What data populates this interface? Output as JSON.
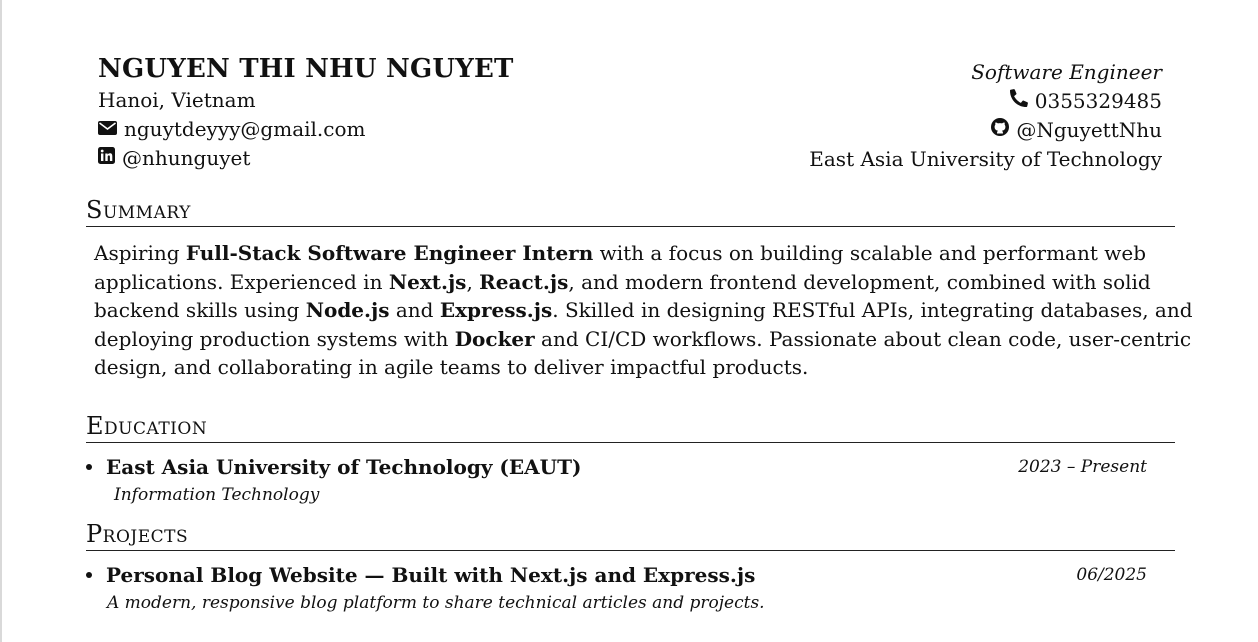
{
  "header": {
    "name": "NGUYEN THI NHU NGUYET",
    "location": "Hanoi, Vietnam",
    "email": "nguytdeyyy@gmail.com",
    "linkedin": "@nhunguyet",
    "role": "Software Engineer",
    "phone": "0355329485",
    "github": "@NguyettNhu",
    "university": "East Asia University of Technology"
  },
  "summary": {
    "title": "Summary",
    "l1_a": "Aspiring ",
    "l1_b": "Full-Stack Software Engineer Intern",
    "l1_c": " with a focus on building scalable and performant web",
    "l2_a": "applications. Experienced in ",
    "l2_b": "Next.js",
    "l2_c": ", ",
    "l2_d": "React.js",
    "l2_e": ", and modern frontend development, combined with solid",
    "l3_a": "backend skills using ",
    "l3_b": "Node.js",
    "l3_c": " and ",
    "l3_d": "Express.js",
    "l3_e": ". Skilled in designing RESTful APIs, integrating databases, and",
    "l4_a": "deploying production systems with ",
    "l4_b": "Docker",
    "l4_c": " and CI/CD workflows. Passionate about clean code, user-centric",
    "l5": "design, and collaborating in agile teams to deliver impactful products."
  },
  "education": {
    "title": "Education",
    "items": [
      {
        "school": "East Asia University of Technology (EAUT)",
        "dates": "2023 – Present",
        "major": "Information Technology"
      }
    ]
  },
  "projects": {
    "title": "Projects",
    "items": [
      {
        "name": "Personal Blog Website — Built with Next.js and Express.js",
        "date": "06/2025",
        "description": "A modern, responsive blog platform to share technical articles and projects."
      }
    ]
  },
  "icons": {
    "email": "envelope-icon",
    "linkedin": "linkedin-icon",
    "phone": "phone-icon",
    "github": "github-icon"
  }
}
